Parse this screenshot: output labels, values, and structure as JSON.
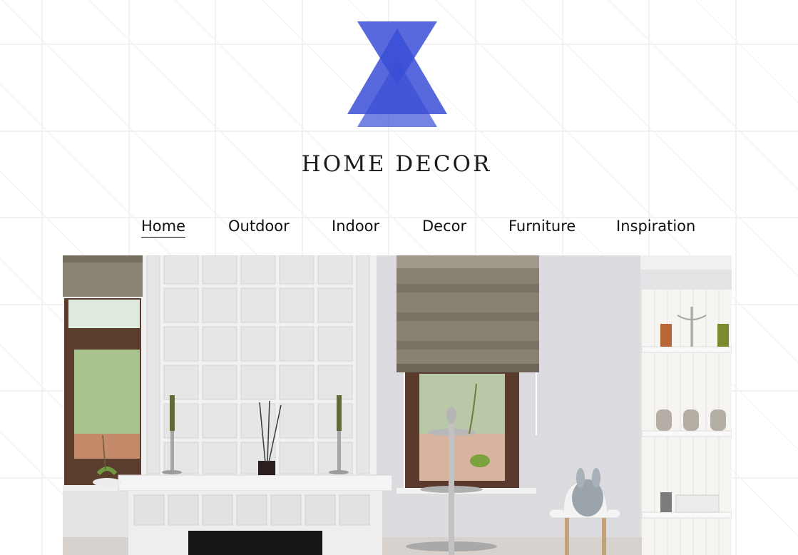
{
  "site": {
    "title": "HOME DECOR",
    "logo_icon": "overlapping-triangles-logo",
    "brand_color": "#3a4fd6",
    "brand_color_light": "#6f7be6"
  },
  "nav": {
    "items": [
      {
        "label": "Home",
        "active": true
      },
      {
        "label": "Outdoor",
        "active": false
      },
      {
        "label": "Indoor",
        "active": false
      },
      {
        "label": "Decor",
        "active": false
      },
      {
        "label": "Furniture",
        "active": false
      },
      {
        "label": "Inspiration",
        "active": false
      }
    ]
  },
  "hero": {
    "image": "living-room-with-fireplace-photo"
  }
}
